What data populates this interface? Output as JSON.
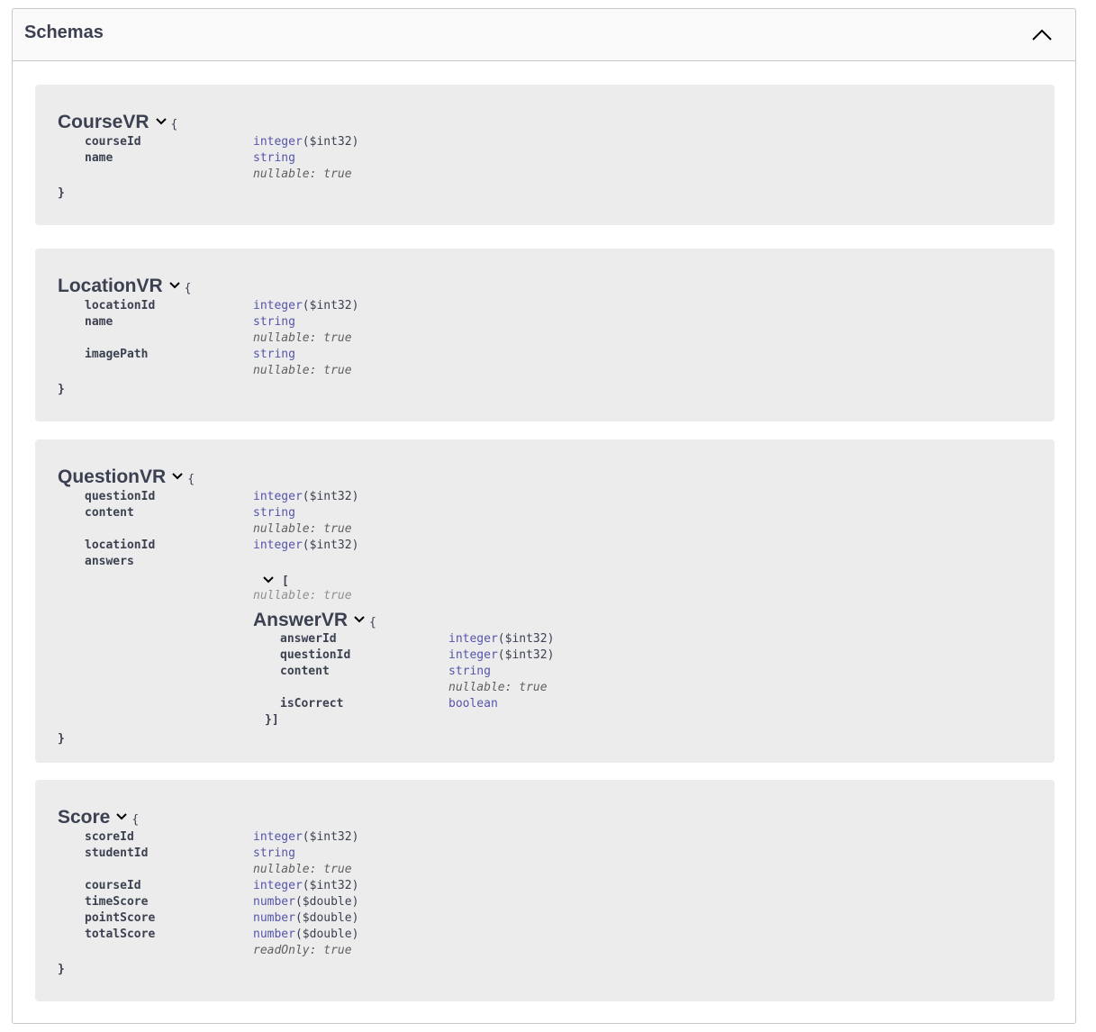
{
  "section": {
    "title": "Schemas"
  },
  "models": {
    "course": {
      "name": "CourseVR",
      "open": "{",
      "close": "}",
      "props": [
        {
          "name": "courseId",
          "type": "integer",
          "format": "($int32)"
        },
        {
          "name": "name",
          "type": "string",
          "format": "",
          "meta": "nullable: true"
        }
      ]
    },
    "location": {
      "name": "LocationVR",
      "open": "{",
      "close": "}",
      "props": [
        {
          "name": "locationId",
          "type": "integer",
          "format": "($int32)"
        },
        {
          "name": "name",
          "type": "string",
          "format": "",
          "meta": "nullable: true"
        },
        {
          "name": "imagePath",
          "type": "string",
          "format": "",
          "meta": "nullable: true"
        }
      ]
    },
    "question": {
      "name": "QuestionVR",
      "open": "{",
      "close": "}",
      "props": [
        {
          "name": "questionId",
          "type": "integer",
          "format": "($int32)"
        },
        {
          "name": "content",
          "type": "string",
          "format": "",
          "meta": "nullable: true"
        },
        {
          "name": "locationId",
          "type": "integer",
          "format": "($int32)"
        },
        {
          "name": "answers"
        }
      ],
      "answers": {
        "array_open": "[",
        "meta": "nullable: true",
        "array_close": "}]",
        "model": {
          "name": "AnswerVR",
          "open": "{",
          "props": [
            {
              "name": "answerId",
              "type": "integer",
              "format": "($int32)"
            },
            {
              "name": "questionId",
              "type": "integer",
              "format": "($int32)"
            },
            {
              "name": "content",
              "type": "string",
              "format": "",
              "meta": "nullable: true"
            },
            {
              "name": "isCorrect",
              "type": "boolean",
              "format": ""
            }
          ]
        }
      }
    },
    "score": {
      "name": "Score",
      "open": "{",
      "close": "}",
      "props": [
        {
          "name": "scoreId",
          "type": "integer",
          "format": "($int32)"
        },
        {
          "name": "studentId",
          "type": "string",
          "format": "",
          "meta": "nullable: true"
        },
        {
          "name": "courseId",
          "type": "integer",
          "format": "($int32)"
        },
        {
          "name": "timeScore",
          "type": "number",
          "format": "($double)"
        },
        {
          "name": "pointScore",
          "type": "number",
          "format": "($double)"
        },
        {
          "name": "totalScore",
          "type": "number",
          "format": "($double)",
          "meta": "readOnly: true"
        }
      ]
    }
  },
  "colors": {
    "type_keyword": "#5555aa",
    "text": "#3b4151",
    "model_bg": "#ececec"
  },
  "icons": {
    "collapse": "chevron-up-icon",
    "expand": "chevron-down-icon"
  }
}
